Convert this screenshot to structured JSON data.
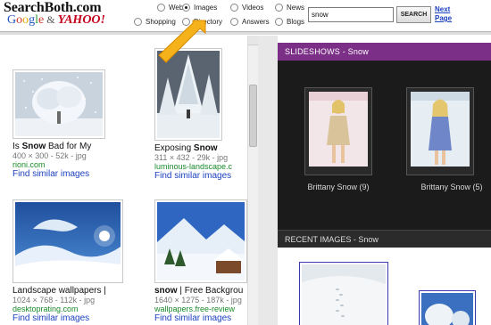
{
  "header": {
    "logo_main": "SearchBoth.com",
    "logo_and": "&",
    "logo_google": "Google",
    "logo_yahoo": "YAHOO!",
    "search_value": "snow",
    "search_button": "SEARCH",
    "next_page": "Next Page",
    "options": [
      {
        "label": "Web",
        "selected": false
      },
      {
        "label": "Images",
        "selected": true
      },
      {
        "label": "Videos",
        "selected": false
      },
      {
        "label": "News",
        "selected": false
      },
      {
        "label": "Shopping",
        "selected": false
      },
      {
        "label": "Directory",
        "selected": false
      },
      {
        "label": "Answers",
        "selected": false
      },
      {
        "label": "Blogs",
        "selected": false
      }
    ]
  },
  "results": [
    {
      "title_pre": "Is ",
      "title_bold": "Snow",
      "title_post": " Bad for My",
      "meta": "400 × 300 - 52k - jpg",
      "source": "rioni.com",
      "similar": "Find similar images"
    },
    {
      "title_pre": "Exposing ",
      "title_bold": "Snow",
      "title_post": "",
      "meta": "311 × 432 - 29k - jpg",
      "source": "luminous-landscape.c",
      "similar": "Find similar images"
    },
    {
      "title_pre": "Landscape wallpapers |",
      "title_bold": "",
      "title_post": "",
      "meta": "1024 × 768 - 112k - jpg",
      "source": "desktoprating.com",
      "similar": "Find similar images"
    },
    {
      "title_pre": "",
      "title_bold": "snow",
      "title_post": " | Free Backgrou",
      "meta": "1640 × 1275 - 187k - jpg",
      "source": "wallpapers.free-review",
      "similar": "Find similar images"
    }
  ],
  "slideshows": {
    "header": "SLIDESHOWS - Snow",
    "items": [
      {
        "caption": "Brittany Snow (9)"
      },
      {
        "caption": "Brittany Snow (5)"
      }
    ]
  },
  "recent": {
    "header": "RECENT IMAGES - Snow"
  }
}
